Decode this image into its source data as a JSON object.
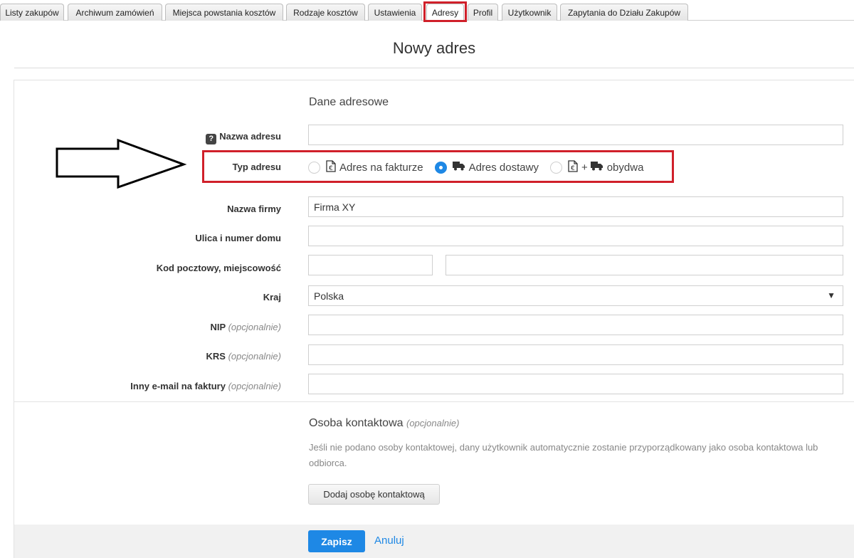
{
  "tabs": [
    {
      "label": "Listy zakupów"
    },
    {
      "label": "Archiwum zamówień"
    },
    {
      "label": "Miejsca powstania kosztów"
    },
    {
      "label": "Rodzaje kosztów"
    },
    {
      "label": "Ustawienia"
    },
    {
      "label": "Adresy",
      "active": true
    },
    {
      "label": "Profil"
    },
    {
      "label": "Użytkownik"
    },
    {
      "label": "Zapytania do Działu Zakupów"
    }
  ],
  "page": {
    "title": "Nowy adres"
  },
  "address_section": {
    "heading": "Dane adresowe",
    "help_badge": "?",
    "address_name_label": "Nazwa adresu",
    "address_name_value": "",
    "address_type_label": "Typ adresu",
    "address_type_options": [
      {
        "label": "Adres na fakturze",
        "checked": false,
        "icon": "invoice-icon"
      },
      {
        "label": "Adres dostawy",
        "checked": true,
        "icon": "truck-icon"
      },
      {
        "label": "obydwa",
        "checked": false,
        "icon": "invoice-plus-truck-icon",
        "plus": "+"
      }
    ],
    "company_label": "Nazwa firmy",
    "company_value": "Firma XY",
    "street_label": "Ulica i numer domu",
    "street_value": "",
    "postal_label": "Kod pocztowy, miejscowość",
    "postal_value": "",
    "city_value": "",
    "country_label": "Kraj",
    "country_value": "Polska",
    "nip_label": "NIP",
    "krs_label": "KRS",
    "email_label": "Inny e-mail na faktury",
    "optional": "(opcjonalnie)"
  },
  "contact_section": {
    "heading": "Osoba kontaktowa",
    "optional": "(opcjonalnie)",
    "description": "Jeśli nie podano osoby kontaktowej, dany użytkownik automatycznie zostanie przyporządkowany jako osoba kontaktowa lub odbiorca.",
    "add_button": "Dodaj osobę kontaktową"
  },
  "footer": {
    "save": "Zapisz",
    "cancel": "Anuluj"
  },
  "colors": {
    "accent": "#1e88e5",
    "highlight": "#d0202a"
  }
}
